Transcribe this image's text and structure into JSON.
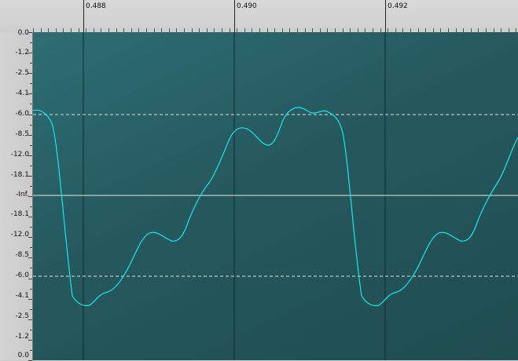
{
  "time_ruler": {
    "labels": [
      "0.488",
      "0.490",
      "0.492"
    ]
  },
  "db_scale": {
    "labels": [
      "0.0",
      "-1.2",
      "-2.5",
      "-4.1",
      "-6.0",
      "-8.5",
      "-12.0",
      "-18.1",
      "-Inf.",
      "-18.1",
      "-12.0",
      "-8.5",
      "-6.0",
      "-4.1",
      "-2.5",
      "-1.2",
      "0.0"
    ]
  },
  "colors": {
    "waveform": "#19e6ee",
    "background": "#25585d",
    "center_line": "#e0e0e0",
    "guide_line": "#e0e0e0"
  }
}
